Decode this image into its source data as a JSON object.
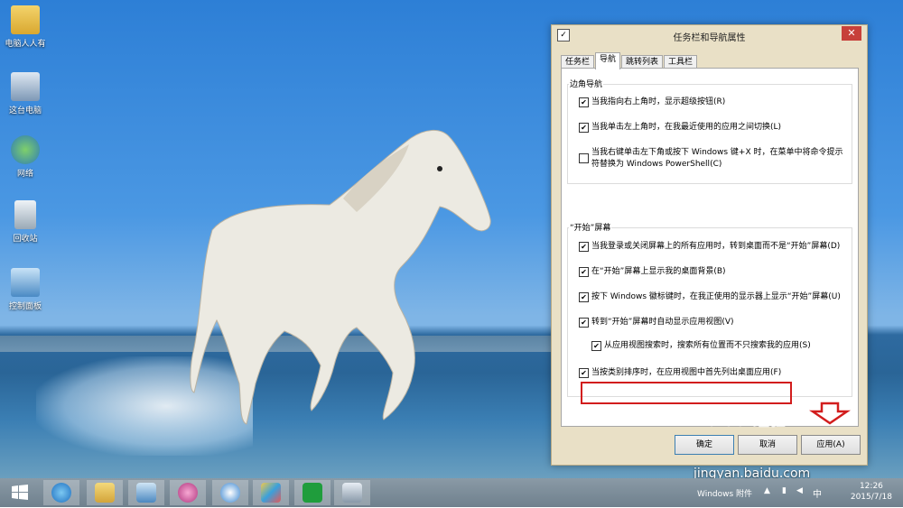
{
  "desktop": {
    "icons": [
      {
        "label": "电脑人人有"
      },
      {
        "label": "这台电脑"
      },
      {
        "label": "网络"
      },
      {
        "label": "回收站"
      },
      {
        "label": "控制面板"
      }
    ]
  },
  "dialog": {
    "title": "任务栏和导航属性",
    "close_label": "✕",
    "tabs": [
      "任务栏",
      "导航",
      "跳转列表",
      "工具栏"
    ],
    "active_tab": "导航",
    "corner_nav": {
      "label": "边角导航",
      "options": [
        {
          "text": "当我指向右上角时，显示超级按钮(R)",
          "checked": true
        },
        {
          "text": "当我单击左上角时，在我最近使用的应用之间切换(L)",
          "checked": true
        },
        {
          "text": "当我右键单击左下角或按下 Windows 键+X 时，在菜单中将命令提示符替换为 Windows PowerShell(C)",
          "checked": false
        }
      ]
    },
    "start_screen": {
      "label": "“开始”屏幕",
      "options": [
        {
          "text": "当我登录或关闭屏幕上的所有应用时，转到桌面而不是“开始”屏幕(D)",
          "checked": true
        },
        {
          "text": "在“开始”屏幕上显示我的桌面背景(B)",
          "checked": true
        },
        {
          "text": "按下 Windows 徽标键时，在我正使用的显示器上显示“开始”屏幕(U)",
          "checked": true
        },
        {
          "text": "转到“开始”屏幕时自动显示应用视图(V)",
          "checked": true
        },
        {
          "text": "从应用视图搜索时，搜索所有位置而不只搜索我的应用(S)",
          "checked": true
        },
        {
          "text": "当按类别排序时，在应用视图中首先列出桌面应用(F)",
          "checked": true
        }
      ]
    },
    "buttons": {
      "ok": "确定",
      "cancel": "取消",
      "apply": "应用(A)"
    },
    "check_glyph": "✔"
  },
  "watermark": {
    "brand": "Baidu 经验",
    "url": "jingyan.baidu.com"
  },
  "taskbar": {
    "apps": [
      "start",
      "internet-explorer",
      "file-explorer",
      "control-panel",
      "media-app",
      "sogou",
      "paint",
      "store",
      "window-app"
    ],
    "tray_label": "Windows 附件",
    "ime": "中",
    "time": "12:26",
    "date": "2015/7/18"
  },
  "colors": {
    "highlight_border": "#d21d1d",
    "dialog_bg": "#e9e0c6",
    "taskbar": "#7a8b97"
  }
}
